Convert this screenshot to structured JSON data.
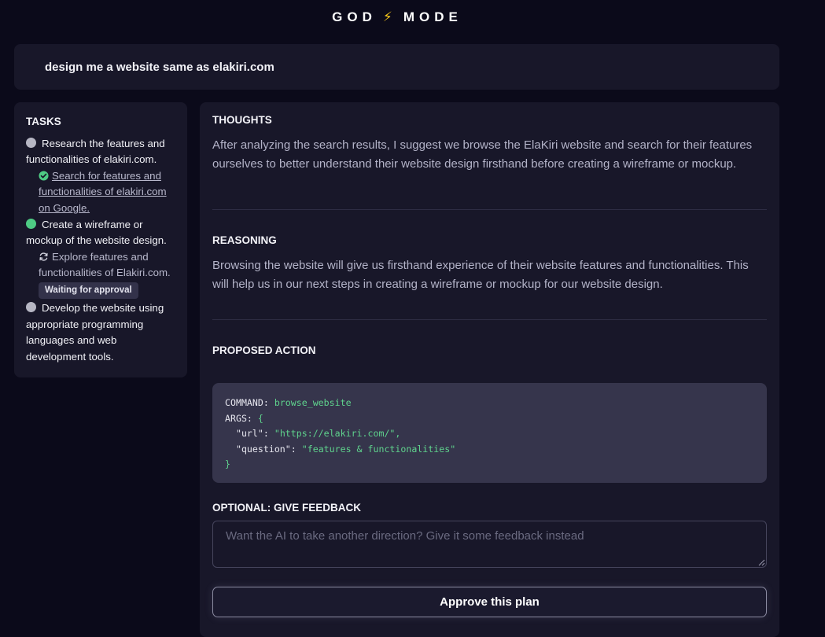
{
  "app": {
    "title_left": "GOD",
    "title_right": "MODE",
    "title_icon": "lightning-bolt"
  },
  "prompt": {
    "text": "design me a website same as elakiri.com"
  },
  "tasks": {
    "title": "TASKS",
    "items": [
      {
        "label": "Research the features and functionalities of elakiri.com.",
        "status": "grey",
        "subtask": {
          "label": "Search for features and functionalities of elakiri.com on Google.",
          "icon": "check-circle-icon"
        }
      },
      {
        "label": "Create a wireframe or mockup of the website design.",
        "status": "green",
        "subtask": {
          "label": "Explore features and functionalities of Elakiri.com.",
          "icon": "sync-icon",
          "badge": "Waiting for approval"
        }
      },
      {
        "label": "Develop the website using appropriate programming languages and web development tools.",
        "status": "grey"
      }
    ]
  },
  "thoughts": {
    "title": "THOUGHTS",
    "text": "After analyzing the search results, I suggest we browse the ElaKiri website and search for their features ourselves to better understand their website design firsthand before creating a wireframe or mockup."
  },
  "reasoning": {
    "title": "REASONING",
    "text": "Browsing the website will give us firsthand experience of their website features and functionalities. This will help us in our next steps in creating a wireframe or mockup for our website design."
  },
  "proposed_action": {
    "title": "PROPOSED ACTION",
    "command_label": "COMMAND:",
    "command_value": "browse_website",
    "args_label": "ARGS:",
    "args_open": "{",
    "args": [
      {
        "key": "\"url\"",
        "value": "\"https://elakiri.com/\","
      },
      {
        "key": "\"question\"",
        "value": "\"features & functionalities\""
      }
    ],
    "args_close": "}"
  },
  "feedback": {
    "title": "OPTIONAL: GIVE FEEDBACK",
    "placeholder": "Want the AI to take another direction? Give it some feedback instead",
    "value": ""
  },
  "approve_button": {
    "label": "Approve this plan"
  },
  "colors": {
    "background": "#0b0a1a",
    "panel": "#181729",
    "code_bg": "#36354c",
    "accent_green": "#4ecb84",
    "bolt": "#f5c518"
  }
}
